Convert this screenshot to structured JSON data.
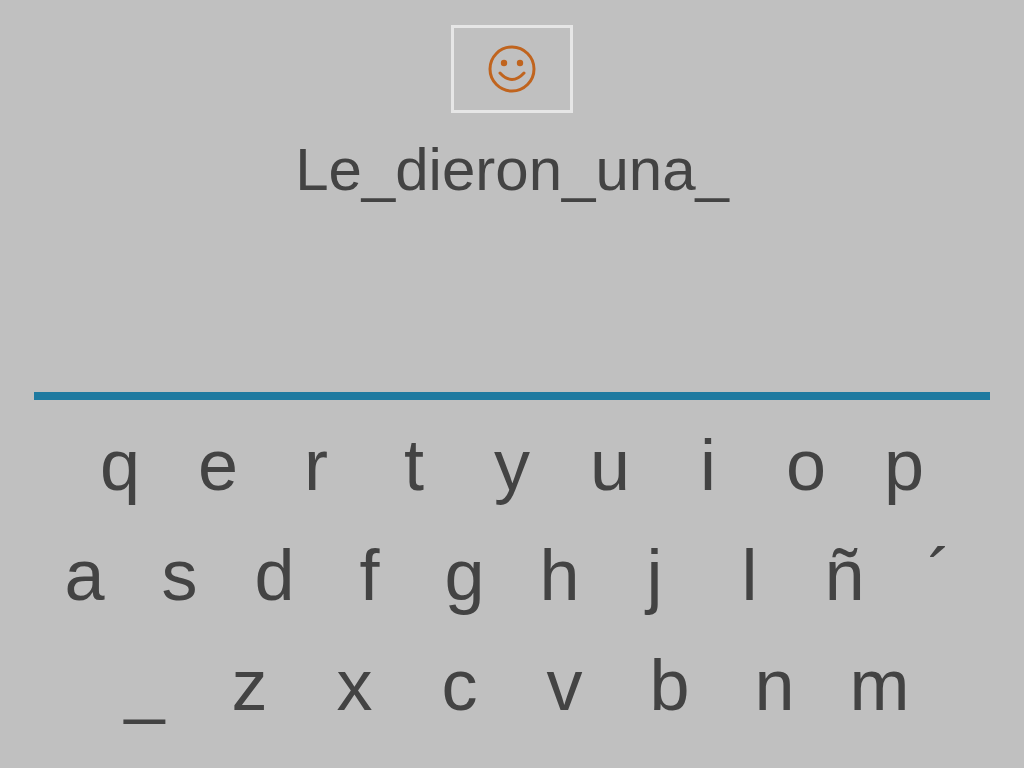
{
  "sentence": "Le_dieron_una_",
  "keyboard": {
    "rows": [
      [
        "q",
        "e",
        "r",
        "t",
        "y",
        "u",
        "i",
        "o",
        "p"
      ],
      [
        "a",
        "s",
        "d",
        "f",
        "g",
        "h",
        "j",
        "l",
        "ñ",
        "´"
      ],
      [
        "_",
        "z",
        "x",
        "c",
        "v",
        "b",
        "n",
        "m"
      ]
    ]
  }
}
